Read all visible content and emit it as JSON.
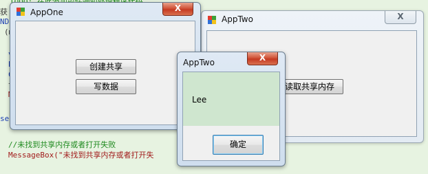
{
  "editor": {
    "lines": [
      {
        "text": "TODO: 在此添加控件通知处理程序代码",
        "cls": "c-green"
      },
      {
        "text": "获",
        "cls": "c-dark"
      },
      {
        "text": "NDL",
        "cls": "c-blue"
      },
      {
        "text": "(m",
        "cls": "c-dark"
      },
      {
        "text": "v",
        "cls": "c-blue"
      },
      {
        "text": "b",
        "cls": "c-blue"
      },
      {
        "text": "C",
        "cls": "c-blue"
      },
      {
        "text": "t",
        "cls": "c-dark"
      },
      {
        "text": "M",
        "cls": "c-red"
      },
      {
        "text": "se",
        "cls": "c-blue"
      },
      {
        "text": "//未找到共享内存或者打开失败",
        "cls": "c-green"
      },
      {
        "text": "MessageBox(\"未找到共享内存或者打开失",
        "cls": "c-red"
      }
    ]
  },
  "app_one": {
    "title": "AppOne",
    "close_label": "X",
    "create_share_label": "创建共享",
    "write_data_label": "写数据"
  },
  "app_two": {
    "title": "AppTwo",
    "close_label": "X",
    "read_share_label": "读取共享内存"
  },
  "message_box": {
    "title": "AppTwo",
    "close_label": "X",
    "message": "Lee",
    "ok_label": "确定"
  },
  "colors": {
    "editor_background": "#e7f3e1",
    "close_button_red": "#c53a22",
    "message_area": "#cfe6cf"
  }
}
